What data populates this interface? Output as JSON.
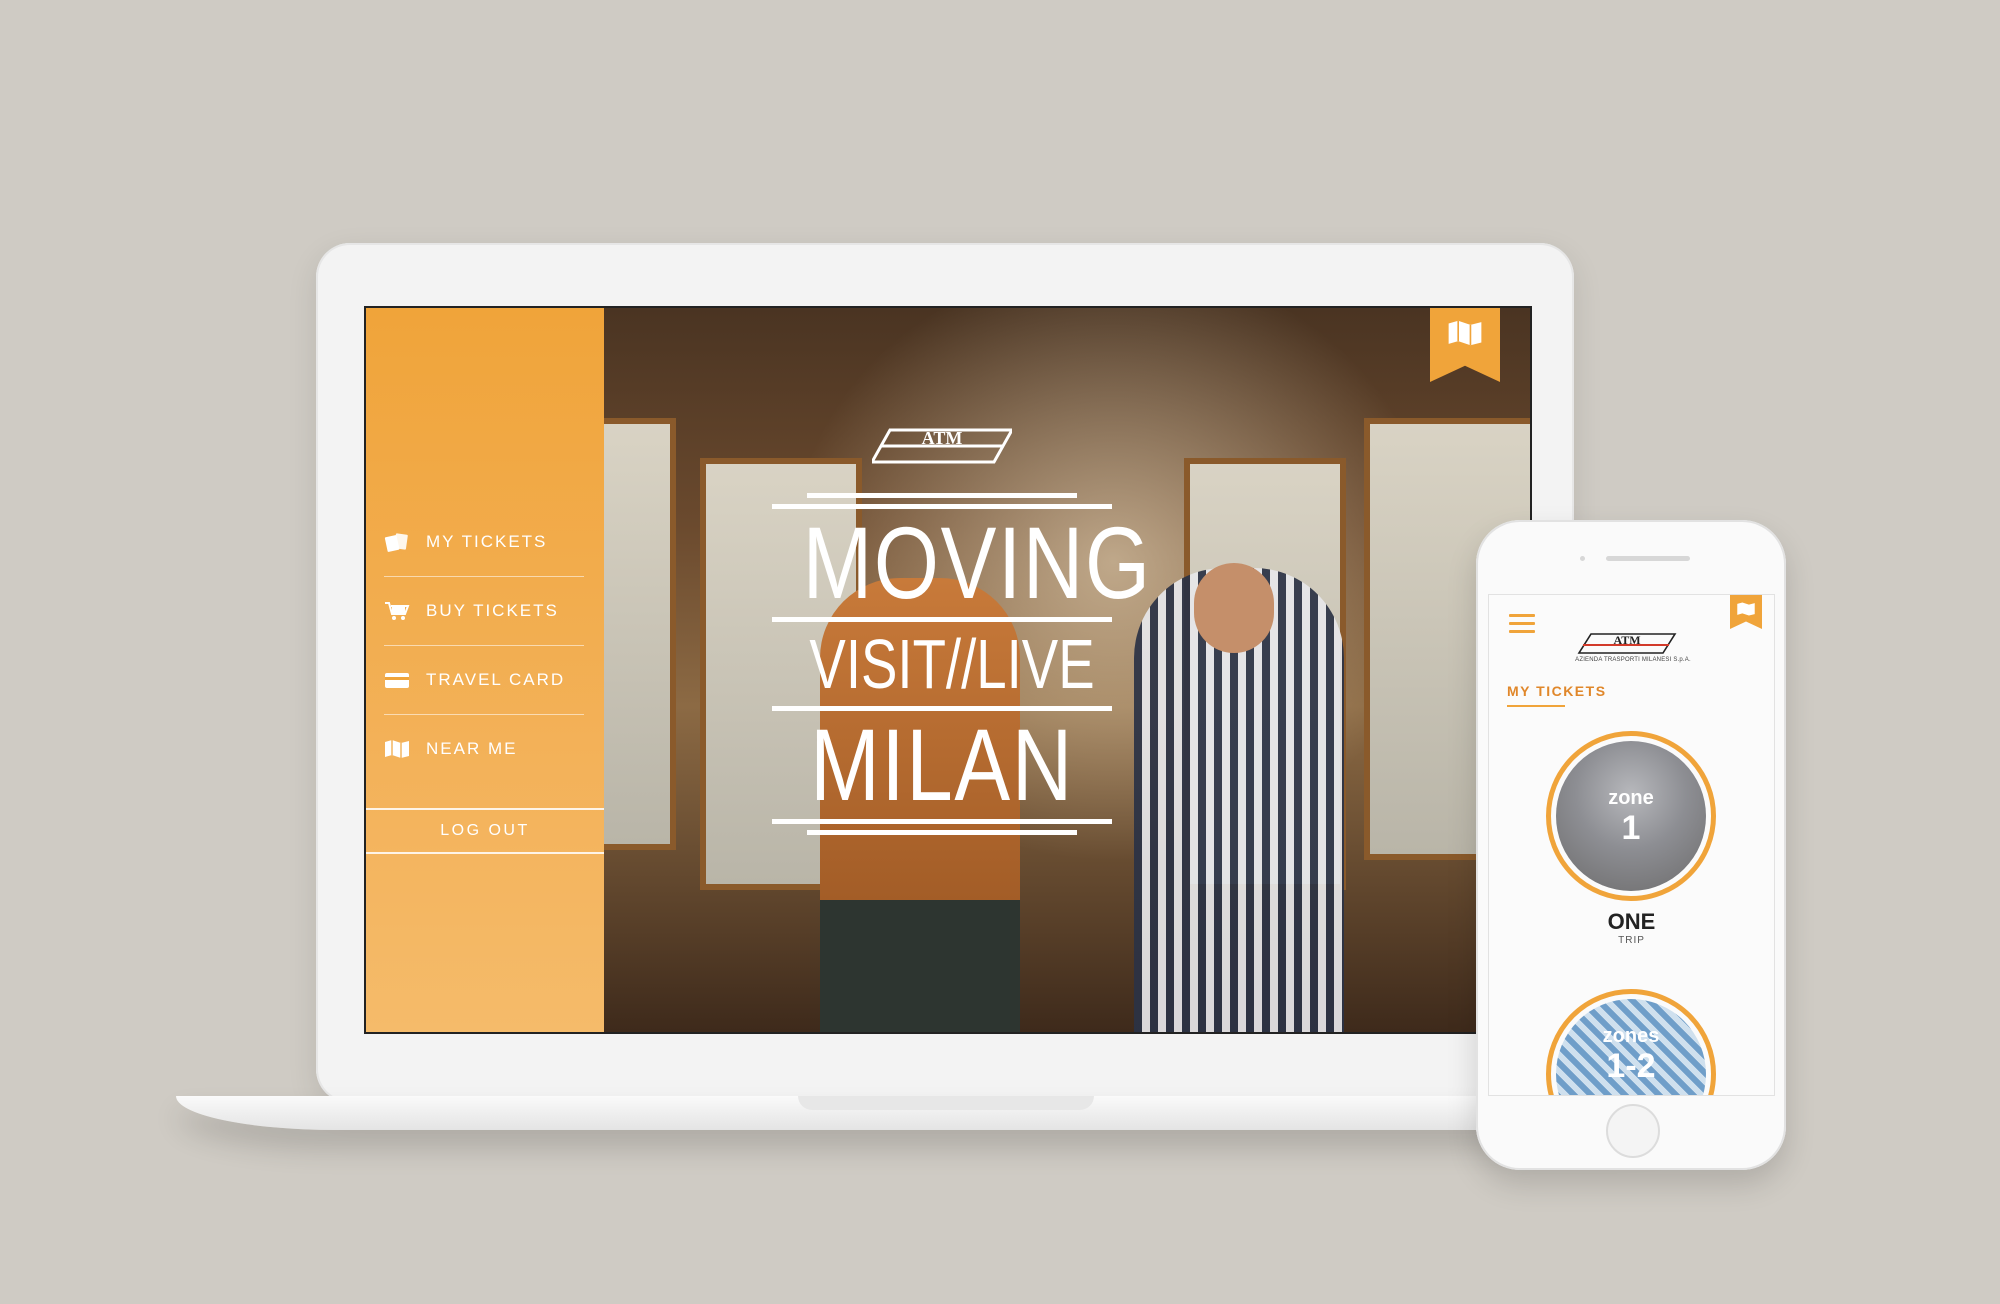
{
  "laptop": {
    "sidebar": {
      "items": [
        {
          "label": "MY TICKETS",
          "icon": "tickets-icon"
        },
        {
          "label": "BUY TICKETS",
          "icon": "cart-icon"
        },
        {
          "label": "TRAVEL CARD",
          "icon": "card-icon"
        },
        {
          "label": "NEAR ME",
          "icon": "map-icon"
        }
      ],
      "logout_label": "LOG OUT"
    },
    "hero": {
      "logo_text": "ATM",
      "line1": "MOVING",
      "line2": "VISIT//LIVE",
      "line3": "MILAN"
    }
  },
  "phone": {
    "logo_text": "ATM",
    "logo_subtitle": "AZIENDA TRASPORTI MILANESI S.p.A.",
    "section_title": "MY TICKETS",
    "tickets": [
      {
        "zone_word": "zone",
        "zone_number": "1",
        "name": "ONE",
        "sub": "TRIP"
      },
      {
        "zone_word": "zones",
        "zone_number": "1-2",
        "name": "",
        "sub": ""
      }
    ]
  },
  "colors": {
    "accent": "#f0a43a",
    "accent_text": "#e0872a",
    "background": "#cfcbc4"
  }
}
